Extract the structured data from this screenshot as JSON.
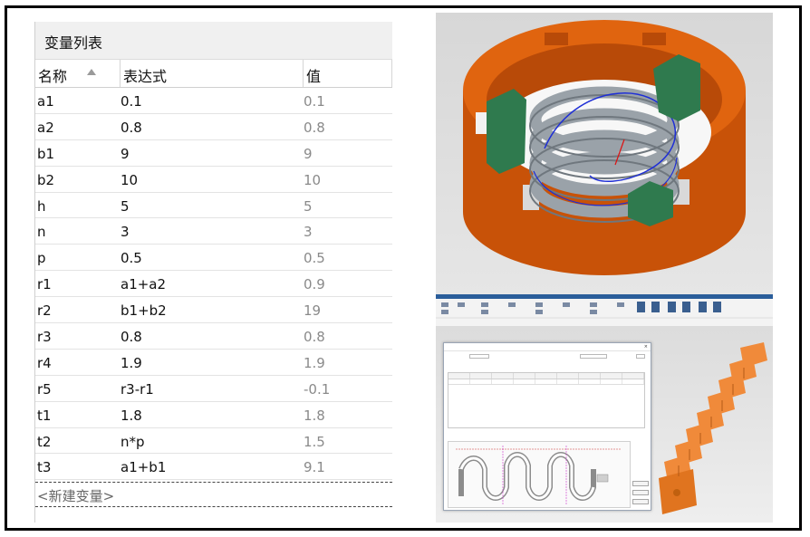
{
  "variable_panel": {
    "title": "变量列表",
    "columns": {
      "name": "名称",
      "expression": "表达式",
      "value": "值"
    },
    "rows": [
      {
        "name": "a1",
        "expression": "0.1",
        "value": "0.1"
      },
      {
        "name": "a2",
        "expression": "0.8",
        "value": "0.8"
      },
      {
        "name": "b1",
        "expression": "9",
        "value": "9"
      },
      {
        "name": "b2",
        "expression": "10",
        "value": "10"
      },
      {
        "name": "h",
        "expression": "5",
        "value": "5"
      },
      {
        "name": "n",
        "expression": "3",
        "value": "3"
      },
      {
        "name": "p",
        "expression": "0.5",
        "value": "0.5"
      },
      {
        "name": "r1",
        "expression": "a1+a2",
        "value": "0.9"
      },
      {
        "name": "r2",
        "expression": "b1+b2",
        "value": "19"
      },
      {
        "name": "r3",
        "expression": "0.8",
        "value": "0.8"
      },
      {
        "name": "r4",
        "expression": "1.9",
        "value": "1.9"
      },
      {
        "name": "r5",
        "expression": "r3-r1",
        "value": "-0.1"
      },
      {
        "name": "t1",
        "expression": "1.8",
        "value": "1.8"
      },
      {
        "name": "t2",
        "expression": "n*p",
        "value": "1.5"
      },
      {
        "name": "t3",
        "expression": "a1+b1",
        "value": "9.1"
      }
    ],
    "new_variable": "<新建变量>"
  },
  "colors": {
    "housing": "#e0640f",
    "housing_dark": "#b84a08",
    "coil": "#a9b0b6",
    "coil_dark": "#7d858c",
    "clip": "#2f7a4e",
    "helix": "#1f2fd6",
    "ribbon_accent": "#2a5d9a",
    "part_orange": "#f08a3a"
  },
  "icons": {
    "sort": "sort-ascending-icon",
    "close": "close-icon"
  }
}
